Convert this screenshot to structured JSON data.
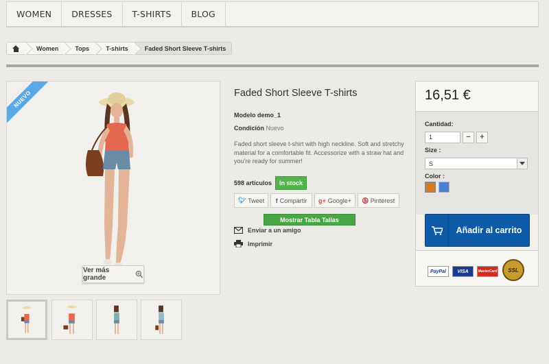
{
  "menu": [
    "WOMEN",
    "DRESSES",
    "T-SHIRTS",
    "BLOG"
  ],
  "breadcrumb": {
    "home_icon": "home-icon",
    "items": [
      "Women",
      "Tops",
      "T-shirts",
      "Faded Short Sleeve T-shirts"
    ]
  },
  "product": {
    "new_label": "NUEVO",
    "zoom_label": "Ver más grande",
    "title": "Faded Short Sleeve T-shirts",
    "model_label": "Modelo",
    "model_value": "demo_1",
    "condition_label": "Condición",
    "condition_value": "Nuevo",
    "description": "Faded short sleeve t-shirt with high neckline. Soft and stretchy material for a comfortable fit. Accessorize with a straw hat and you're ready for summer!",
    "stock_count": "598 artículos",
    "stock_status": "In stock",
    "social": [
      {
        "icon": "twitter-icon",
        "label": "Tweet"
      },
      {
        "icon": "facebook-icon",
        "label": "Compartir"
      },
      {
        "icon": "google-plus-icon",
        "label": "Google+"
      },
      {
        "icon": "pinterest-icon",
        "label": "Pinterest"
      }
    ],
    "size_chart_label": "Mostrar Tabla Tallas",
    "send_friend_label": "Enviar a un amigo",
    "print_label": "Imprimir"
  },
  "buybox": {
    "price": "16,51 €",
    "quantity_label": "Cantidad:",
    "quantity_value": "1",
    "size_label": "Size :",
    "size_value": "S",
    "color_label": "Color :",
    "colors": [
      "#d97a1e",
      "#4a7fd4"
    ],
    "add_to_cart_label": "Añadir al carrito",
    "payment_logos": [
      "PayPal",
      "VISA",
      "MasterCard",
      "SSL"
    ]
  },
  "colors": {
    "accent_blue": "#0d5aa6",
    "in_stock_green": "#55b34e",
    "new_ribbon": "#5aa9e4"
  }
}
